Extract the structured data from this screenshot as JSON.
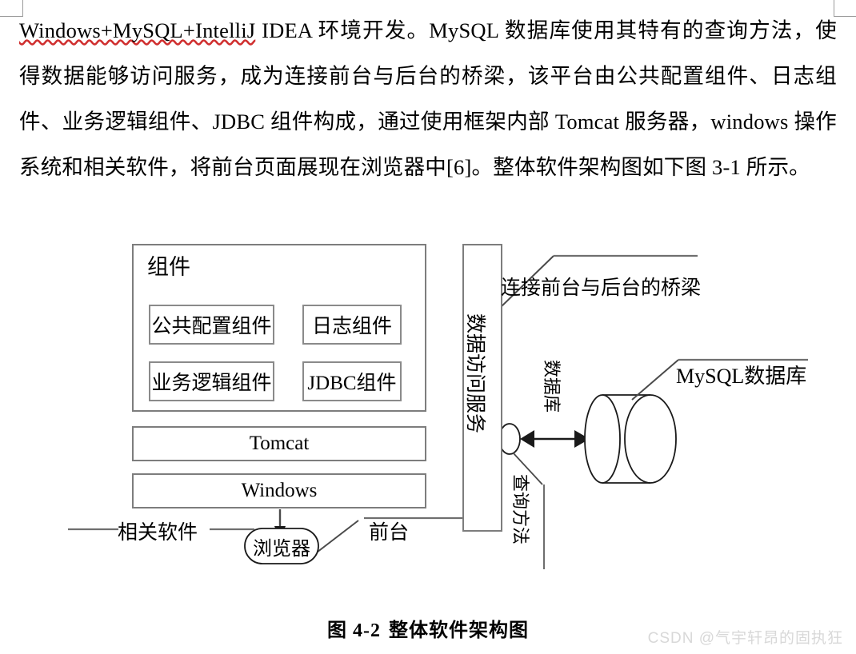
{
  "page": {
    "background": "#ffffff",
    "text_color": "#000000",
    "line_color": "#7d7d7d",
    "watermark_color": "#d8d8d8"
  },
  "paragraph": {
    "segments": [
      {
        "text": "Windows+MySQL+IntelliJ",
        "squiggle": false
      },
      {
        "text": " IDEA 环境开发。MySQL 数据库使用其特有的查询方法，使得数据能够访问服务，成为连接前台与后台的桥梁，该平台由公共配置组件、日志组件、业务逻辑组件、JDBC 组件构成，通过使用框架内部 Tomcat 服务器，windows 操作系统和相关软件，将前台页面展现在浏览器中[6]。整体软件架构图如下图 3-1 所示。",
        "squiggle": false
      }
    ],
    "full_text": "Windows+MySQL+IntelliJ IDEA 环境开发。MySQL 数据库使用其特有的查询方法，使得数据能够访问服务，成为连接前台与后台的桥梁，该平台由公共配置组件、日志组件、业务逻辑组件、JDBC 组件构成，通过使用框架内部 Tomcat 服务器，windows 操作系统和相关软件，将前台页面展现在浏览器中[6]。整体软件架构图如下图 3-1 所示。"
  },
  "diagram": {
    "component_group": {
      "title": "组件",
      "items": [
        {
          "label": "公共配置组件"
        },
        {
          "label": "日志组件"
        },
        {
          "label": "业务逻辑组件"
        },
        {
          "label": "JDBC组件"
        }
      ]
    },
    "stack": [
      {
        "label": "Tomcat"
      },
      {
        "label": "Windows"
      }
    ],
    "browser": {
      "label": "浏览器"
    },
    "labels": {
      "related_software": "相关软件",
      "frontend": "前台",
      "data_access_service": "数据访问服务",
      "bridge_callout": "连接前台与后台的桥梁",
      "database_link": "数据库",
      "query_method": "查询方法",
      "mysql_callout": "MySQL数据库"
    }
  },
  "caption": {
    "number": "图 4-2",
    "title": "整体软件架构图"
  },
  "watermark": {
    "text": "CSDN @气宇轩昂的固执狂"
  }
}
